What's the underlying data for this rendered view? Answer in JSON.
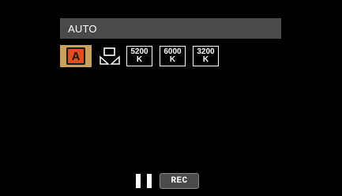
{
  "mode": {
    "label": "AUTO"
  },
  "white_balance": {
    "auto_label": "A",
    "selected": "auto",
    "presets": [
      {
        "value": "5200",
        "unit": "K"
      },
      {
        "value": "6000",
        "unit": "K"
      },
      {
        "value": "3200",
        "unit": "K"
      }
    ]
  },
  "status": {
    "state": "paused",
    "rec_label": "REC"
  },
  "colors": {
    "selected_bg": "#c9a15a",
    "auto_icon_bg": "#e24d1c",
    "bar_bg": "#4a4a4a"
  }
}
